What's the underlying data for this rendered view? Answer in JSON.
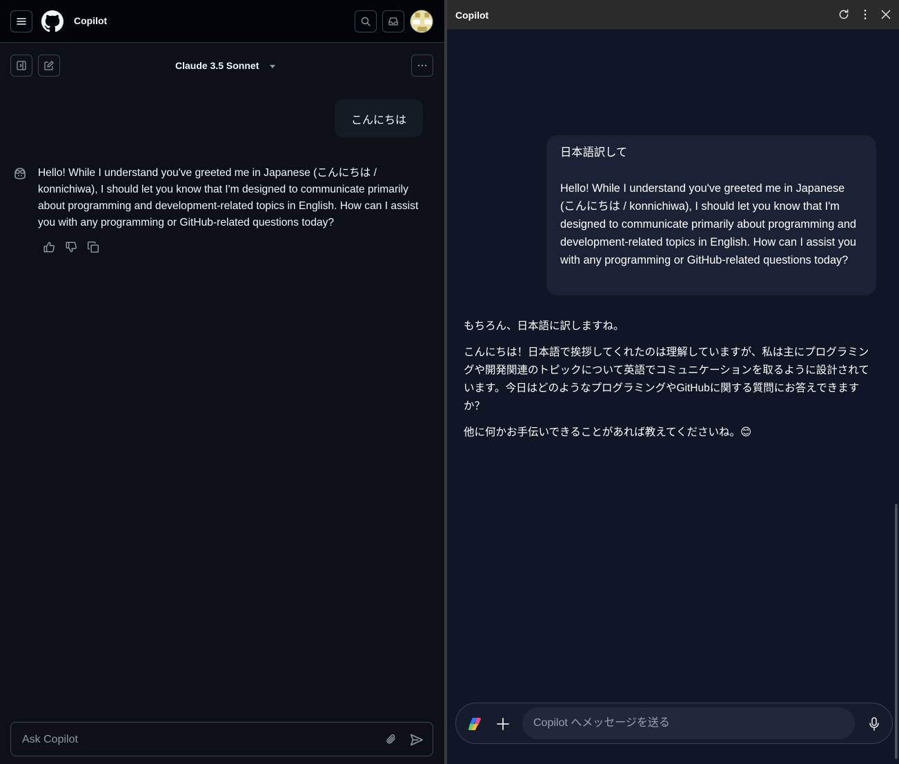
{
  "left": {
    "header": {
      "title": "Copilot"
    },
    "toolbar": {
      "model": "Claude 3.5 Sonnet"
    },
    "conversation": {
      "user_message": "こんにちは",
      "assistant_message": "Hello! While I understand you've greeted me in Japanese (こんにちは / konnichiwa), I should let you know that I'm designed to communicate primarily about programming and development-related topics in English. How can I assist you with any programming or GitHub-related questions today?"
    },
    "composer": {
      "placeholder": "Ask Copilot"
    },
    "icons": [
      "hamburger-icon",
      "github-logo",
      "search-icon",
      "inbox-icon",
      "avatar",
      "sidebar-toggle-icon",
      "new-chat-icon",
      "more-icon",
      "copilot-bot-icon",
      "thumbs-up-icon",
      "thumbs-down-icon",
      "copy-icon",
      "paperclip-icon",
      "send-icon"
    ]
  },
  "right": {
    "titlebar": {
      "title": "Copilot"
    },
    "conversation": {
      "user_line1": "日本語訳して",
      "user_quote": "Hello! While I understand you've greeted me in Japanese (こんにちは / konnichiwa), I should let you know that I'm designed to communicate primarily about programming and development-related topics in English. How can I assist you with any programming or GitHub-related questions today?",
      "reply_p1": "もちろん、日本語に訳しますね。",
      "reply_p2": "こんにちは！日本語で挨拶してくれたのは理解していますが、私は主にプログラミングや開発関連のトピックについて英語でコミュニケーションを取るように設計されています。今日はどのようなプログラミングやGitHubに関する質問にお答えできますか？",
      "reply_p3": "他に何かお手伝いできることがあれば教えてくださいね。😊"
    },
    "composer": {
      "placeholder": "Copilot へメッセージを送る"
    },
    "icons": [
      "refresh-icon",
      "kebab-menu-icon",
      "close-icon",
      "copilot-logo",
      "plus-icon",
      "microphone-icon"
    ]
  },
  "colors": {
    "left_bg": "#0d1117",
    "right_bg": "#101626",
    "text": "#f0f6fc"
  }
}
